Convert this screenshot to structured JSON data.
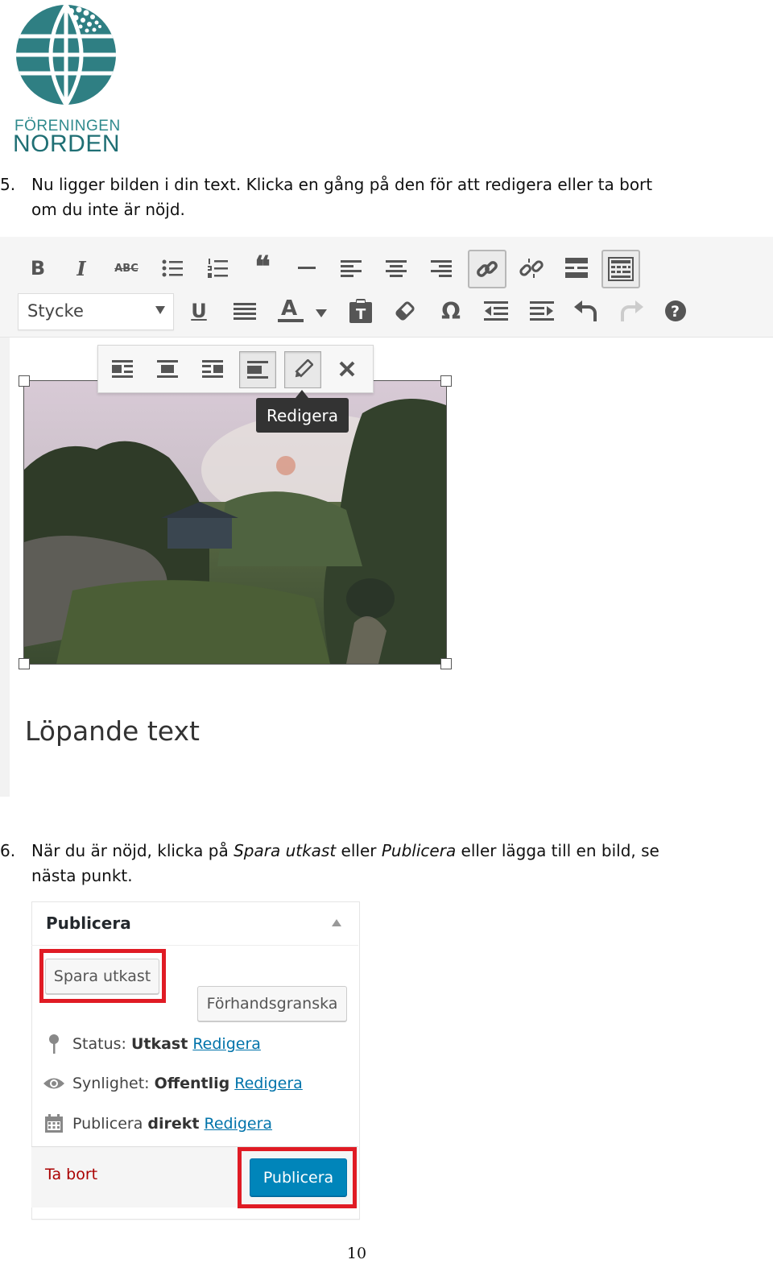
{
  "logo": {
    "line1": "FÖRENINGEN",
    "line2": "NORDEN",
    "color": "#2f7f83"
  },
  "steps": [
    {
      "num": "5.",
      "line1": "Nu ligger bilden i din text. Klicka en gång på den för att redigera eller ta bort",
      "line2": "om du inte är nöjd."
    },
    {
      "num": "6.",
      "pre": "När du är nöjd, klicka på ",
      "em1": "Spara utkast",
      "mid": " eller ",
      "em2": "Publicera",
      "post": " eller lägga till en bild, se",
      "line2": "nästa punkt."
    }
  ],
  "editor": {
    "format_select": "Stycke",
    "toolbar_row1": [
      "bold-icon",
      "italic-icon",
      "strikethrough-icon",
      "bullet-list-icon",
      "numbered-list-icon",
      "blockquote-icon",
      "horizontal-line-icon",
      "align-left-icon",
      "align-center-icon",
      "align-right-icon",
      "link-icon",
      "unlink-icon",
      "read-more-icon",
      "toolbar-toggle-icon"
    ],
    "toolbar_row2": [
      "underline-icon",
      "justify-icon",
      "text-color-icon",
      "paste-text-icon",
      "clear-formatting-icon",
      "special-character-icon",
      "outdent-icon",
      "indent-icon",
      "undo-icon",
      "redo-icon",
      "help-icon"
    ],
    "image_toolbar": [
      "align-left-icon",
      "align-center-icon",
      "align-right-icon",
      "no-align-icon",
      "edit-pencil-icon",
      "remove-x-icon"
    ],
    "tooltip": "Redigera",
    "body_text": "Löpande text"
  },
  "publish_box": {
    "title": "Publicera",
    "save_draft": "Spara utkast",
    "preview": "Förhandsgranska",
    "status_label": "Status:",
    "status_value": "Utkast",
    "visibility_label": "Synlighet:",
    "visibility_value": "Offentlig",
    "publish_label": "Publicera",
    "publish_value": "direkt",
    "edit_link": "Redigera",
    "trash": "Ta bort",
    "publish_button": "Publicera",
    "highlight_color": "#e01b24",
    "primary_color": "#0085ba"
  },
  "page_number": "10"
}
